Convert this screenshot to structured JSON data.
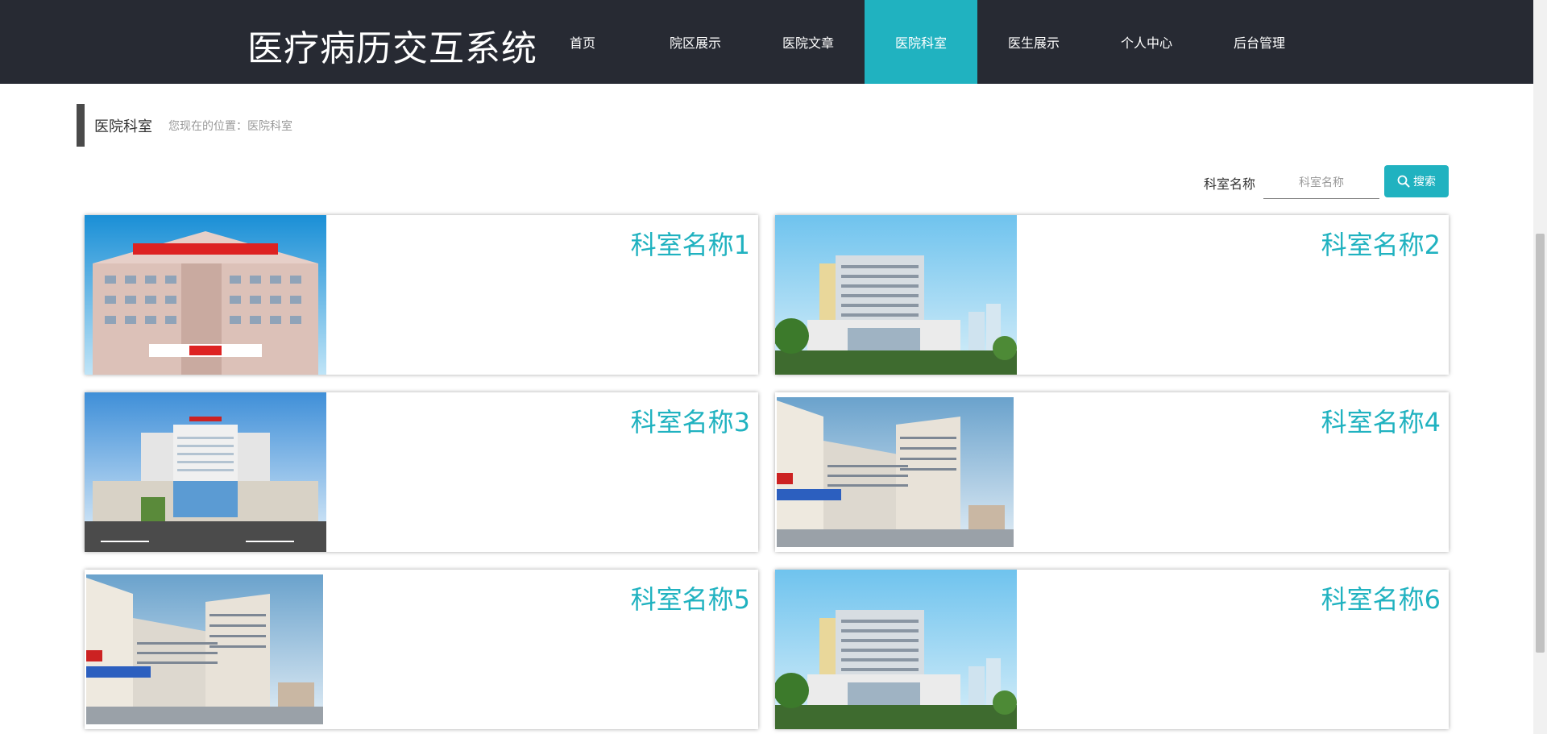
{
  "app": {
    "title": "医疗病历交互系统"
  },
  "nav": [
    {
      "label": "首页"
    },
    {
      "label": "院区展示"
    },
    {
      "label": "医院文章"
    },
    {
      "label": "医院科室",
      "active": true
    },
    {
      "label": "医生展示"
    },
    {
      "label": "个人中心"
    },
    {
      "label": "后台管理"
    }
  ],
  "breadcrumb": {
    "title": "医院科室",
    "location": "您现在的位置：医院科室"
  },
  "search": {
    "label": "科室名称",
    "placeholder": "科室名称",
    "button_label": "搜索"
  },
  "departments": [
    {
      "name": "科室名称1",
      "image": "hospital-photo-1"
    },
    {
      "name": "科室名称2",
      "image": "hospital-photo-2"
    },
    {
      "name": "科室名称3",
      "image": "hospital-photo-3"
    },
    {
      "name": "科室名称4",
      "image": "hospital-photo-4"
    },
    {
      "name": "科室名称5",
      "image": "hospital-photo-5"
    },
    {
      "name": "科室名称6",
      "image": "hospital-photo-6"
    }
  ],
  "colors": {
    "header_bg": "#272a33",
    "accent": "#20b2c0"
  }
}
